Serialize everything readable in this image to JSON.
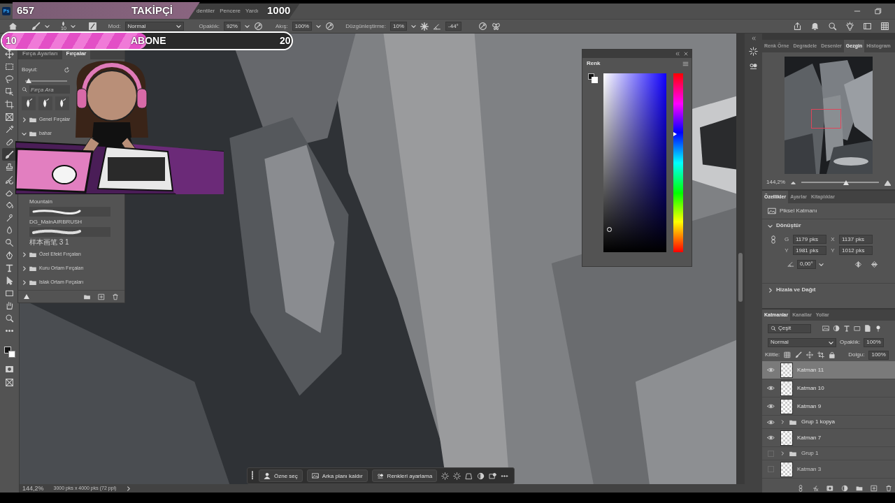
{
  "stream_overlay": {
    "followers": {
      "count": "657",
      "label": "TAKİPÇİ",
      "goal": "1000",
      "level": 0.65
    },
    "subscribers": {
      "count": "10",
      "label": "ABONE",
      "goal": "20",
      "level": 0.5
    }
  },
  "menu_bar": {
    "logo": "Ps",
    "items": [
      "dentiler",
      "Pencere",
      "Yardı"
    ]
  },
  "options_bar": {
    "brush_size": "10",
    "mode_label": "Mod:",
    "mode": "Normal",
    "opacity_label": "Opaklık:",
    "opacity": "92%",
    "flow_label": "Akış:",
    "flow": "100%",
    "smoothing_label": "Düzgünleştirme:",
    "smoothing": "10%",
    "angle": "-44°"
  },
  "brush_panel": {
    "tabs": [
      {
        "label": "Fırça Ayarları",
        "selected": false
      },
      {
        "label": "Fırçalar",
        "selected": true
      }
    ],
    "size_label": "Boyut:",
    "size_slider": {
      "level": 0.08
    },
    "search": {
      "placeholder": "Fırça Ara"
    },
    "groups": [
      {
        "name": "Genel Fırçalar",
        "expanded": false
      },
      {
        "name": "bahar",
        "expanded": true
      }
    ],
    "brushes": [
      {
        "name": "Mountain"
      },
      {
        "name": "DG_MainAIRBRUSH"
      },
      {
        "name": "样本画笔 3 1"
      }
    ],
    "more_groups": [
      {
        "name": "Özel Efekt Fırçaları",
        "expanded": false
      },
      {
        "name": "Kuru Ortam Fırçaları",
        "expanded": false
      },
      {
        "name": "Islak Ortam Fırçaları",
        "expanded": false
      }
    ]
  },
  "color_panel": {
    "title": "Renk",
    "hue_slider": {
      "level": 0.66
    }
  },
  "navigator_panel": {
    "tabs": [
      {
        "label": "Renk Örne",
        "selected": false
      },
      {
        "label": "Degradele",
        "selected": false
      },
      {
        "label": "Desenler",
        "selected": false
      },
      {
        "label": "Gezgin",
        "selected": true
      },
      {
        "label": "Histogram",
        "selected": false
      }
    ],
    "zoom": "144,2%",
    "zoom_slider": {
      "level": 0.58
    }
  },
  "properties_panel": {
    "tabs": [
      {
        "label": "Özellikler",
        "selected": true
      },
      {
        "label": "Ayarlar",
        "selected": false
      },
      {
        "label": "Kitaplıklar",
        "selected": false
      }
    ],
    "layer_type": "Piksel Katmanı",
    "sections": [
      {
        "title": "Dönüştür",
        "expanded": true
      },
      {
        "title": "Hizala ve Dağıt",
        "expanded": false
      }
    ],
    "transform": {
      "fields": [
        {
          "label": "G",
          "value": "1179 pks"
        },
        {
          "label": "X",
          "value": "1137 pks"
        },
        {
          "label": "Y",
          "value": "1981 pks"
        },
        {
          "label": "Y",
          "value": "1012 pks"
        }
      ],
      "angle": "0,00°"
    }
  },
  "layers_panel": {
    "tabs": [
      {
        "label": "Katmanlar",
        "selected": true
      },
      {
        "label": "Kanallar",
        "selected": false
      },
      {
        "label": "Yollar",
        "selected": false
      }
    ],
    "filter": "Çeşit",
    "blend_mode": "Normal",
    "opacity_label": "Opaklık:",
    "opacity": "100%",
    "lock_label": "Kilitle:",
    "fill_label": "Dolgu:",
    "fill": "100%",
    "layers": [
      {
        "name": "Katman 11",
        "kind": "layer",
        "visible": true,
        "selected": true
      },
      {
        "name": "Katman 10",
        "kind": "layer",
        "visible": true,
        "selected": false
      },
      {
        "name": "Katman 9",
        "kind": "layer",
        "visible": true,
        "selected": false
      },
      {
        "name": "Grup 1 kopya",
        "kind": "group",
        "visible": true,
        "selected": false
      },
      {
        "name": "Katman 7",
        "kind": "layer",
        "visible": true,
        "selected": false
      },
      {
        "name": "Grup 1",
        "kind": "group",
        "visible": false,
        "selected": false
      },
      {
        "name": "Katman 3",
        "kind": "layer",
        "visible": false,
        "selected": false
      }
    ]
  },
  "task_bar": {
    "buttons": [
      "Özne seç",
      "Arka planı kaldır",
      "Renkleri ayarlama"
    ]
  },
  "status_bar": {
    "zoom": "144,2%",
    "document_size": "3000 pks x 4000 pks (72 ppi)"
  }
}
